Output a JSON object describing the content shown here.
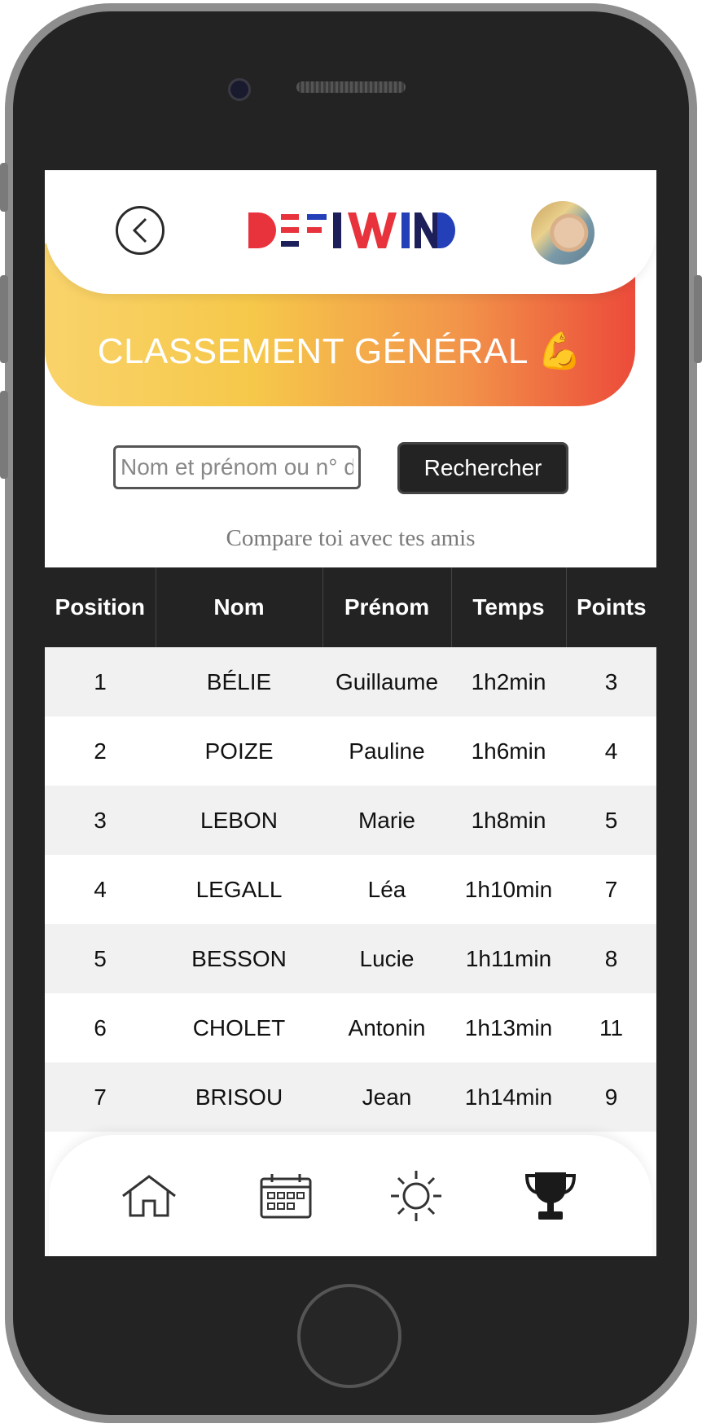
{
  "header": {
    "logo_text": "DEFIWIND",
    "back_icon": "chevron-left-icon",
    "avatar_icon": "user-avatar"
  },
  "banner": {
    "title": "CLASSEMENT GÉNÉRAL 💪"
  },
  "search": {
    "placeholder": "Nom et prénom ou n° de",
    "button_label": "Rechercher"
  },
  "subtitle": "Compare toi avec tes amis",
  "table": {
    "headers": [
      "Position",
      "Nom",
      "Prénom",
      "Temps",
      "Points"
    ],
    "rows": [
      [
        "1",
        "BÉLIE",
        "Guillaume",
        "1h2min",
        "3"
      ],
      [
        "2",
        "POIZE",
        "Pauline",
        "1h6min",
        "4"
      ],
      [
        "3",
        "LEBON",
        "Marie",
        "1h8min",
        "5"
      ],
      [
        "4",
        "LEGALL",
        "Léa",
        "1h10min",
        "7"
      ],
      [
        "5",
        "BESSON",
        "Lucie",
        "1h11min",
        "8"
      ],
      [
        "6",
        "CHOLET",
        "Antonin",
        "1h13min",
        "11"
      ],
      [
        "7",
        "BRISOU",
        "Jean",
        "1h14min",
        "9"
      ]
    ]
  },
  "bottom_nav": {
    "items": [
      "home-icon",
      "calendar-icon",
      "sun-icon",
      "trophy-icon"
    ]
  },
  "colors": {
    "banner_start": "#f9d36b",
    "banner_end": "#ec4b3a",
    "dark": "#232323",
    "logo_red": "#e8323c",
    "logo_blue": "#2440b8",
    "logo_navy": "#1c1f5a"
  }
}
